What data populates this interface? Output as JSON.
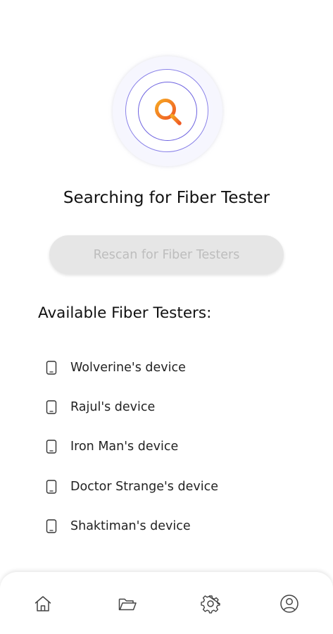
{
  "search": {
    "title": "Searching for Fiber Tester",
    "rescan_label": "Rescan for Fiber Testers"
  },
  "devices": {
    "heading": "Available Fiber Testers:",
    "items": [
      {
        "label": "Wolverine's device",
        "icon": "phone-icon"
      },
      {
        "label": "Rajul's device",
        "icon": "phone-icon"
      },
      {
        "label": "Iron Man's device",
        "icon": "phone-icon"
      },
      {
        "label": "Doctor Strange's device",
        "icon": "phone-icon"
      },
      {
        "label": "Shaktiman's device",
        "icon": "phone-icon"
      }
    ]
  },
  "nav": {
    "items": [
      "home-icon",
      "folder-icon",
      "gear-icon",
      "profile-icon"
    ]
  },
  "colors": {
    "accent": "#f47b20",
    "ring": "#6d62e0",
    "button_bg": "#e6e6e6",
    "button_text": "#bdbdbd"
  }
}
